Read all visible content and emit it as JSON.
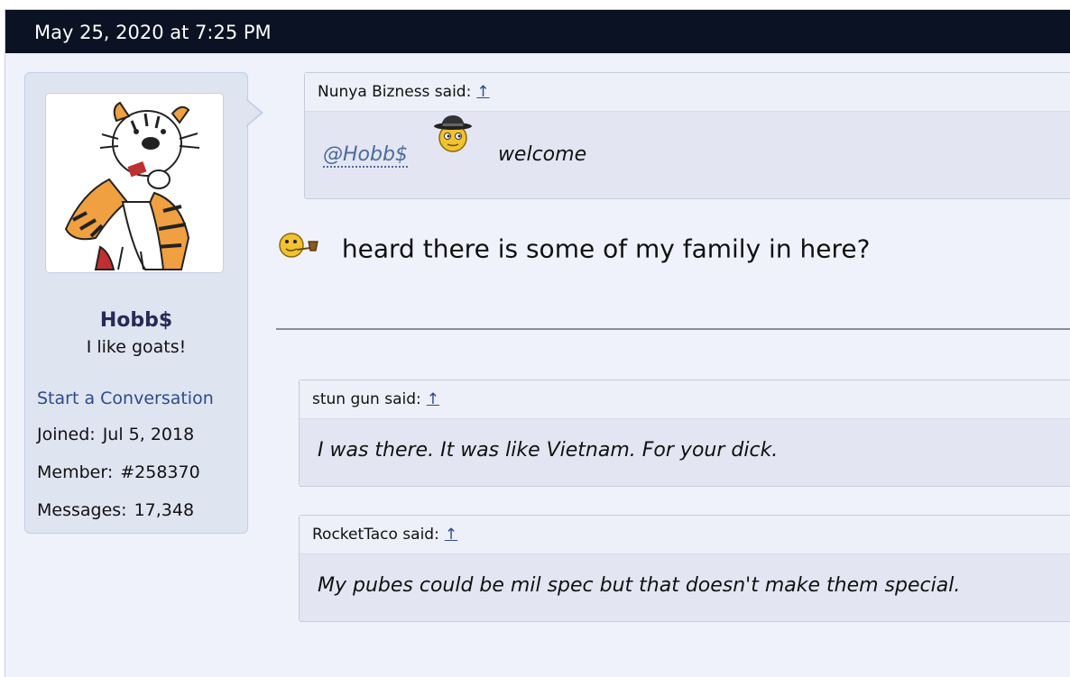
{
  "post": {
    "date": "May 25, 2020 at 7:25 PM"
  },
  "user": {
    "name": "Hobb$",
    "title": "I like goats!",
    "start_conversation": "Start a Conversation",
    "stats": [
      {
        "label": "Joined:",
        "value": "Jul 5, 2018"
      },
      {
        "label": "Member:",
        "value": "#258370"
      },
      {
        "label": "Messages:",
        "value": "17,348"
      }
    ]
  },
  "quotes": [
    {
      "author": "Nunya Bizness said:",
      "arrow": "↑",
      "mention": "@Hobb$",
      "smiley": "detective-smiley-icon",
      "text": "welcome"
    },
    {
      "author": "stun gun said:",
      "arrow": "↑",
      "text": "I was there. It was like Vietnam. For your dick."
    },
    {
      "author": "RocketTaco said:",
      "arrow": "↑",
      "text": "My pubes could be mil spec but that doesn't make them special."
    }
  ],
  "message": {
    "smiley": "pipe-smiley-icon",
    "text": "heard there is some of my family in here?"
  },
  "colors": {
    "header_bg": "#0b1224",
    "page_bg": "#f0f2fb",
    "card_bg": "#dfe4f1",
    "link": "#2d4a8c",
    "username": "#262b57"
  }
}
